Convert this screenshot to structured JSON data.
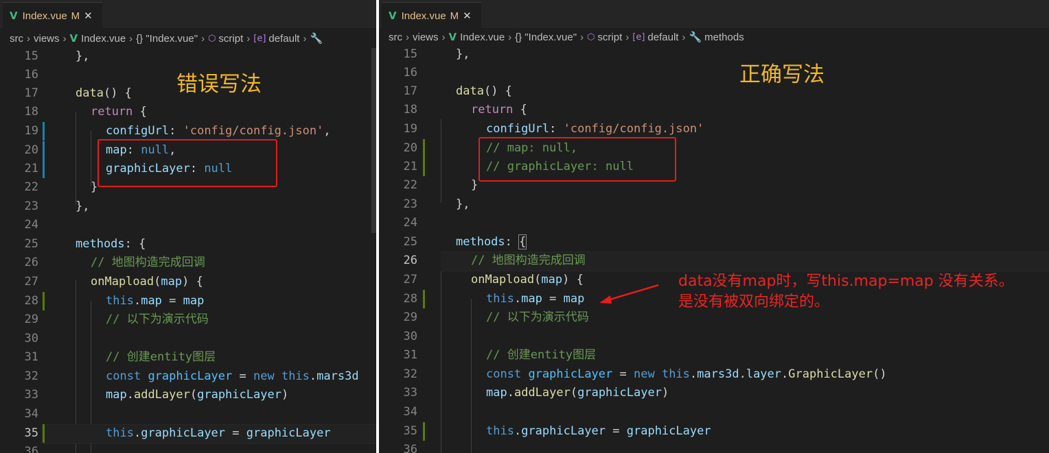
{
  "left_panel": {
    "tab": {
      "icon": "V",
      "filename": "Index.vue",
      "modified": "M",
      "close": "✕"
    },
    "breadcrumb": [
      "src",
      "views",
      "Index.vue",
      "{} \"Index.vue\"",
      "script",
      "default"
    ],
    "heading": "错误写法"
  },
  "right_panel": {
    "tab": {
      "icon": "V",
      "filename": "Index.vue",
      "modified": "M",
      "close": "✕"
    },
    "breadcrumb": [
      "src",
      "views",
      "Index.vue",
      "{} \"Index.vue\"",
      "script",
      "default",
      "methods"
    ],
    "heading": "正确写法",
    "note_line1": "data没有map时，写this.map=map 没有关系。",
    "note_line2": "是没有被双向绑定的。"
  },
  "line_numbers": [
    "15",
    "16",
    "17",
    "18",
    "19",
    "20",
    "21",
    "22",
    "23",
    "24",
    "25",
    "26",
    "27",
    "28",
    "29",
    "30",
    "31",
    "32",
    "33",
    "34",
    "35",
    "36"
  ],
  "colors": {
    "annotation_red": "#e51c1c",
    "heading_yellow": "#f2b824",
    "vue_green": "#41b883"
  }
}
